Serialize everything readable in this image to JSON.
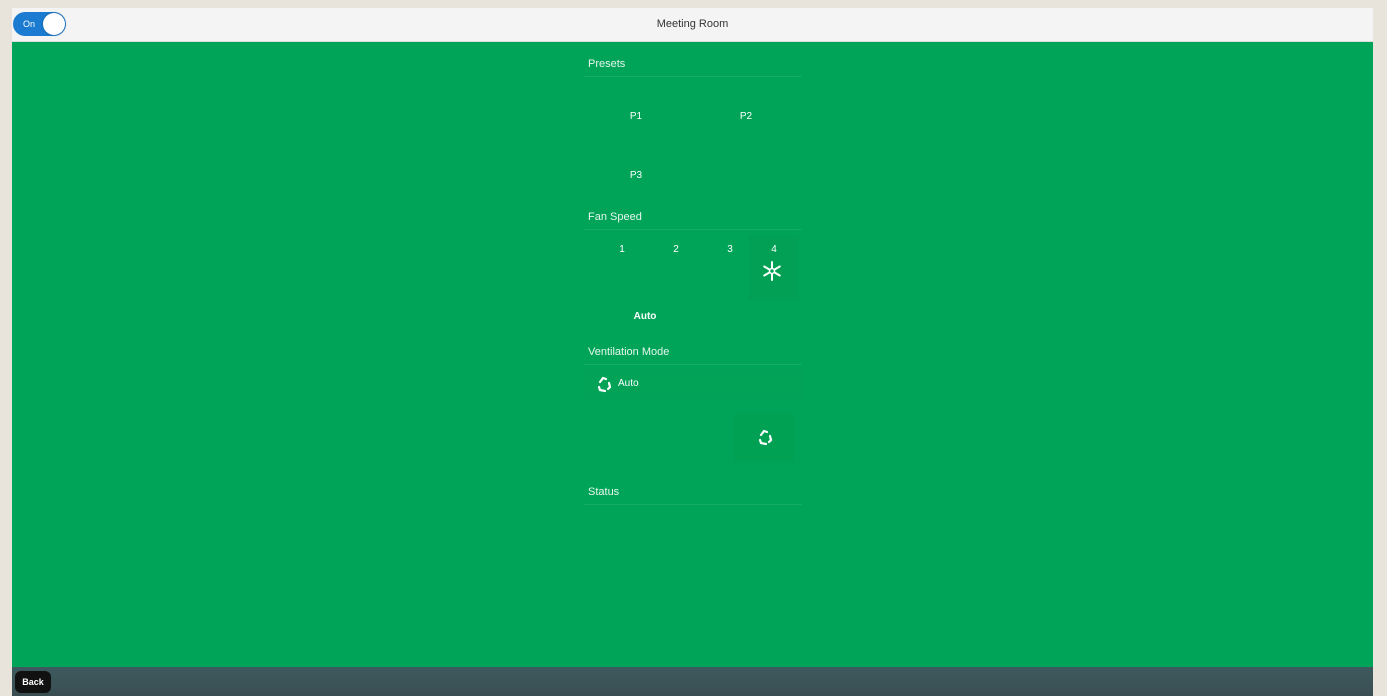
{
  "header": {
    "title": "Meeting Room",
    "power_toggle": {
      "label": "On",
      "state": "on",
      "color": "#1a7bd0"
    }
  },
  "colors": {
    "background": "#00a458",
    "header": "#f4f4f4",
    "footer": "#3d5a5e"
  },
  "presets": {
    "title": "Presets",
    "items": [
      {
        "label": "P1"
      },
      {
        "label": "P2"
      },
      {
        "label": "P3"
      }
    ]
  },
  "fan_speed": {
    "title": "Fan Speed",
    "speeds": [
      {
        "label": "1"
      },
      {
        "label": "2"
      },
      {
        "label": "3"
      },
      {
        "label": "4",
        "active": true,
        "icon": "fan-icon"
      }
    ],
    "auto_label": "Auto"
  },
  "ventilation_mode": {
    "title": "Ventilation Mode",
    "auto": {
      "label": "Auto",
      "icon": "recycle-icon"
    },
    "manual": {
      "icon": "recycle-icon"
    }
  },
  "status": {
    "title": "Status"
  },
  "footer": {
    "back_label": "Back"
  }
}
